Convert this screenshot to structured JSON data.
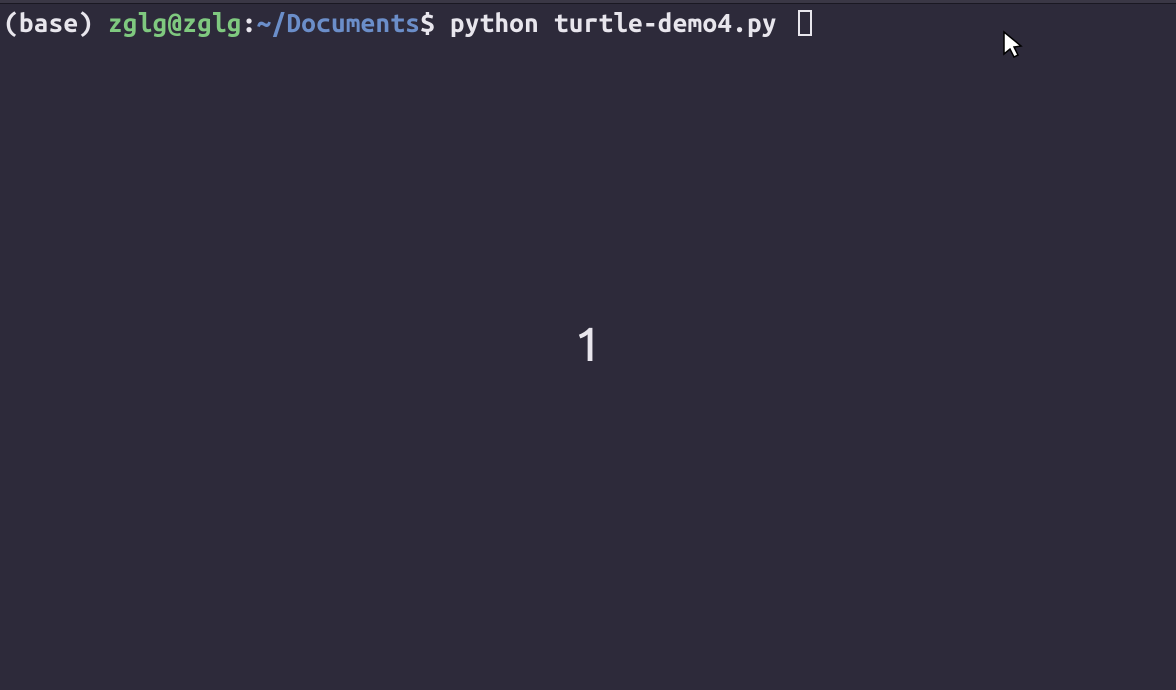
{
  "prompt": {
    "env_prefix": "(base) ",
    "user_host": "zglg@zglg",
    "path_sep": ":",
    "path": "~/Documents",
    "symbol": "$",
    "command": " python turtle-demo4.py "
  },
  "output": {
    "center_value": "1"
  }
}
